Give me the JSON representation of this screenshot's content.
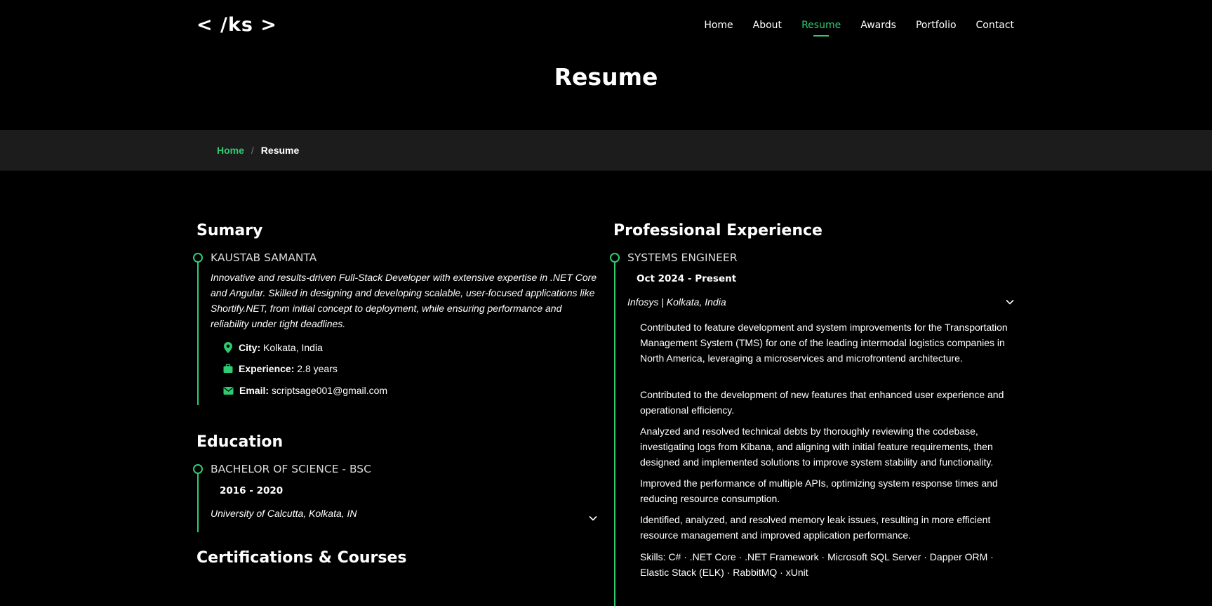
{
  "header": {
    "logo": "< /ks >",
    "nav": [
      "Home",
      "About",
      "Resume",
      "Awards",
      "Portfolio",
      "Contact"
    ],
    "active_nav": "Resume",
    "page_title": "Resume"
  },
  "breadcrumb": {
    "home": "Home",
    "separator": "/",
    "current": "Resume"
  },
  "summary": {
    "heading": "Sumary",
    "name": "KAUSTAB SAMANTA",
    "description": "Innovative and results-driven Full-Stack Developer with extensive expertise in .NET Core and Angular. Skilled in designing and developing scalable, user-focused applications like Shortify.NET, from initial concept to deployment, while ensuring performance and reliability under tight deadlines.",
    "city_label": "City:",
    "city": "Kolkata, India",
    "experience_label": "Experience:",
    "experience": "2.8  years",
    "email_label": "Email:",
    "email": "scriptsage001@gmail.com"
  },
  "education": {
    "heading": "Education",
    "degree": "BACHELOR OF SCIENCE - BSC",
    "years": "2016 - 2020",
    "institution": "University of Calcutta, Kolkata, IN"
  },
  "certifications": {
    "heading": "Certifications & Courses"
  },
  "experience": {
    "heading": "Professional Experience",
    "role": "SYSTEMS ENGINEER",
    "dates": "Oct 2024 - Present",
    "company": "Infosys | Kolkata, India",
    "bullets": [
      "Contributed to feature development and system improvements for the Transportation Management System (TMS) for one of the leading intermodal logistics companies in North America, leveraging a microservices and microfrontend architecture.",
      "Contributed to the development of new features that enhanced user experience and operational efficiency.",
      "Analyzed and resolved technical debts by thoroughly reviewing the codebase, investigating logs from Kibana, and aligning with initial feature requirements, then designed and implemented solutions to improve system stability and functionality.",
      "Improved the performance of multiple APIs, optimizing system response times and reducing resource consumption.",
      "Identified, analyzed, and resolved memory leak issues, resulting in more efficient resource management and improved application performance.",
      "Skills: C# · .NET Core · .NET Framework · Microsoft SQL Server · Dapper ORM · Elastic Stack (ELK) · RabbitMQ · xUnit"
    ]
  },
  "colors": {
    "accent": "#2ecc71",
    "background": "#000000",
    "breadcrumb_bg": "#1c1c1c"
  },
  "icons": [
    "map-pin-icon",
    "briefcase-icon",
    "envelope-icon",
    "chevron-down-icon"
  ]
}
